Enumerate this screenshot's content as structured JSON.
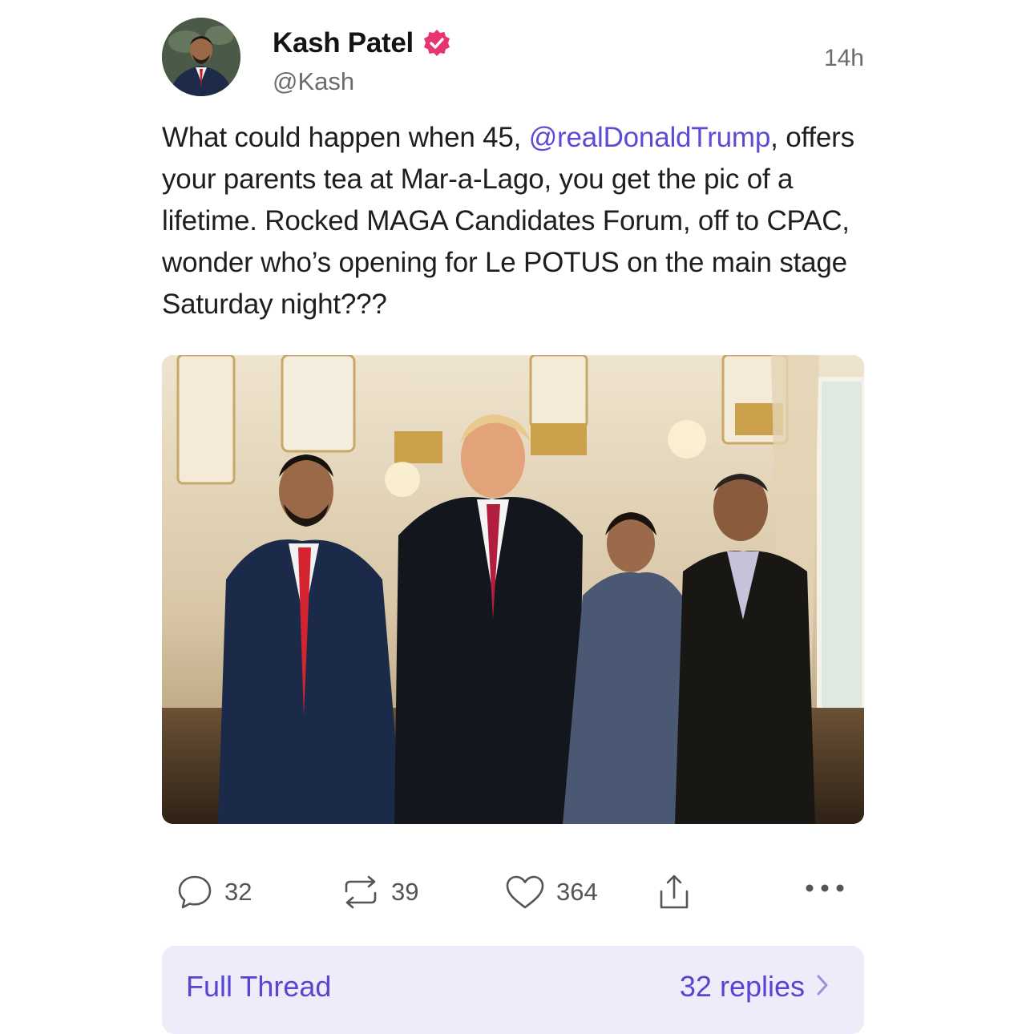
{
  "author": {
    "name": "Kash Patel",
    "handle": "@Kash",
    "verified": true,
    "timestamp": "14h"
  },
  "post": {
    "text_before": "What could happen when 45, ",
    "mention": "@realDonaldTrump",
    "text_after": ", offers your parents tea at Mar-a-Lago, you get the pic of a lifetime. Rocked MAGA Candidates Forum, off to CPAC, wonder who’s opening for Le POTUS on the main stage Saturday night???"
  },
  "actions": {
    "replies": "32",
    "reposts": "39",
    "likes": "364"
  },
  "thread_bar": {
    "label": "Full Thread",
    "replies_label": "32 replies"
  },
  "colors": {
    "accent": "#5646cf",
    "mention": "#5b4bd6",
    "thread_bg": "#eeebfb",
    "verified_badge": "#e8356f"
  },
  "icons": [
    "verified-badge-icon",
    "reply-icon",
    "repost-icon",
    "like-icon",
    "share-icon",
    "more-icon",
    "chevron-right-icon"
  ]
}
